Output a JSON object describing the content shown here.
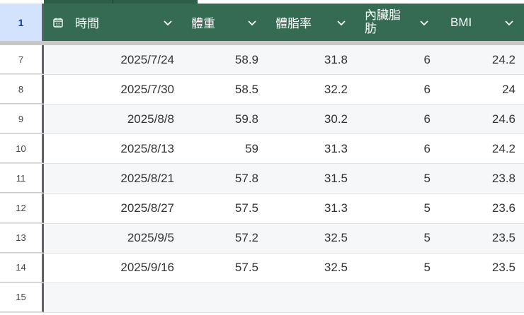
{
  "colors": {
    "header_bg": "#356a53",
    "selected_row_header": "#d3e3fd"
  },
  "header_row_number": "1",
  "columns": [
    {
      "label": "時間",
      "icon": "calendar-icon"
    },
    {
      "label": "體重"
    },
    {
      "label": "體脂率"
    },
    {
      "label": "內臟脂肪"
    },
    {
      "label": "BMI"
    }
  ],
  "rows": [
    {
      "n": "7",
      "cells": [
        "2025/7/24",
        "58.9",
        "31.8",
        "6",
        "24.2"
      ]
    },
    {
      "n": "8",
      "cells": [
        "2025/7/30",
        "58.5",
        "32.2",
        "6",
        "24"
      ]
    },
    {
      "n": "9",
      "cells": [
        "2025/8/8",
        "59.8",
        "30.2",
        "6",
        "24.6"
      ]
    },
    {
      "n": "10",
      "cells": [
        "2025/8/13",
        "59",
        "31.3",
        "6",
        "24.2"
      ]
    },
    {
      "n": "11",
      "cells": [
        "2025/8/21",
        "57.8",
        "31.5",
        "5",
        "23.8"
      ]
    },
    {
      "n": "12",
      "cells": [
        "2025/8/27",
        "57.5",
        "31.3",
        "5",
        "23.6"
      ]
    },
    {
      "n": "13",
      "cells": [
        "2025/9/5",
        "57.2",
        "32.5",
        "5",
        "23.5"
      ]
    },
    {
      "n": "14",
      "cells": [
        "2025/9/16",
        "57.5",
        "32.5",
        "5",
        "23.5"
      ]
    },
    {
      "n": "15",
      "cells": [
        "",
        "",
        "",
        "",
        ""
      ]
    }
  ]
}
